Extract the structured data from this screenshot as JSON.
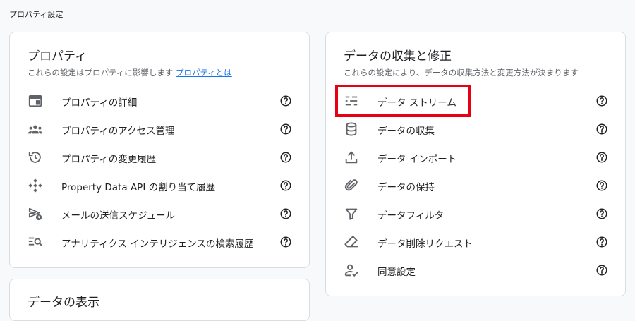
{
  "page": {
    "title": "プロパティ設定"
  },
  "property_card": {
    "title": "プロパティ",
    "description": "これらの設定はプロパティに影響します",
    "link": "プロパティとは",
    "items": [
      {
        "label": "プロパティの詳細",
        "icon": "property-details-icon"
      },
      {
        "label": "プロパティのアクセス管理",
        "icon": "group-icon"
      },
      {
        "label": "プロパティの変更履歴",
        "icon": "history-icon"
      },
      {
        "label": "Property Data API の割り当て履歴",
        "icon": "api-icon"
      },
      {
        "label": "メールの送信スケジュール",
        "icon": "scheduled-send-icon"
      },
      {
        "label": "アナリティクス インテリジェンスの検索履歴",
        "icon": "search-history-icon"
      }
    ]
  },
  "data_card": {
    "title": "データの収集と修正",
    "description": "これらの設定により、データの収集方法と変更方法が決まります",
    "items": [
      {
        "label": "データ ストリーム",
        "icon": "data-stream-icon"
      },
      {
        "label": "データの収集",
        "icon": "database-icon"
      },
      {
        "label": "データ インポート",
        "icon": "upload-icon"
      },
      {
        "label": "データの保持",
        "icon": "attachment-icon"
      },
      {
        "label": "データフィルタ",
        "icon": "filter-icon"
      },
      {
        "label": "データ削除リクエスト",
        "icon": "eraser-icon"
      },
      {
        "label": "同意設定",
        "icon": "consent-icon"
      }
    ]
  },
  "display_card": {
    "title": "データの表示"
  },
  "colors": {
    "accent_link": "#1a73e8",
    "highlight": "#e60012",
    "icon": "#5f6368"
  }
}
